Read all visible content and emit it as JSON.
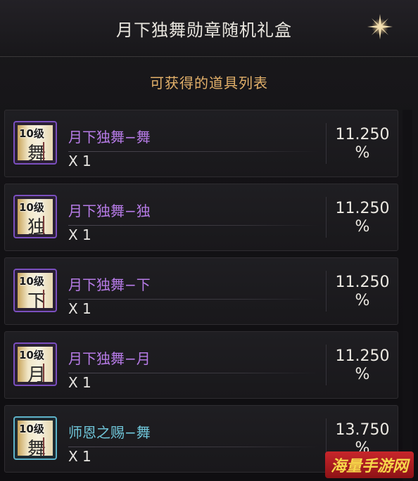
{
  "window": {
    "title": "月下独舞勋章随机礼盒",
    "close_icon": "close-star-icon"
  },
  "subheader": "可获得的道具列表",
  "items": [
    {
      "name": "月下独舞−舞",
      "qty": "X 1",
      "prob_value": "11.250",
      "prob_unit": "%",
      "level": "10级",
      "char": "舞",
      "rarity": "purple"
    },
    {
      "name": "月下独舞−独",
      "qty": "X 1",
      "prob_value": "11.250",
      "prob_unit": "%",
      "level": "10级",
      "char": "独",
      "rarity": "purple"
    },
    {
      "name": "月下独舞−下",
      "qty": "X 1",
      "prob_value": "11.250",
      "prob_unit": "%",
      "level": "10级",
      "char": "下",
      "rarity": "purple"
    },
    {
      "name": "月下独舞−月",
      "qty": "X 1",
      "prob_value": "11.250",
      "prob_unit": "%",
      "level": "10级",
      "char": "月",
      "rarity": "purple"
    },
    {
      "name": "师恩之赐−舞",
      "qty": "X 1",
      "prob_value": "13.750",
      "prob_unit": "%",
      "level": "10级",
      "char": "舞",
      "rarity": "blue"
    }
  ],
  "colors": {
    "purple_name": "#b67be6",
    "blue_name": "#6fc5d8",
    "header_gold": "#e2b06a"
  },
  "watermark": "海量手游网"
}
